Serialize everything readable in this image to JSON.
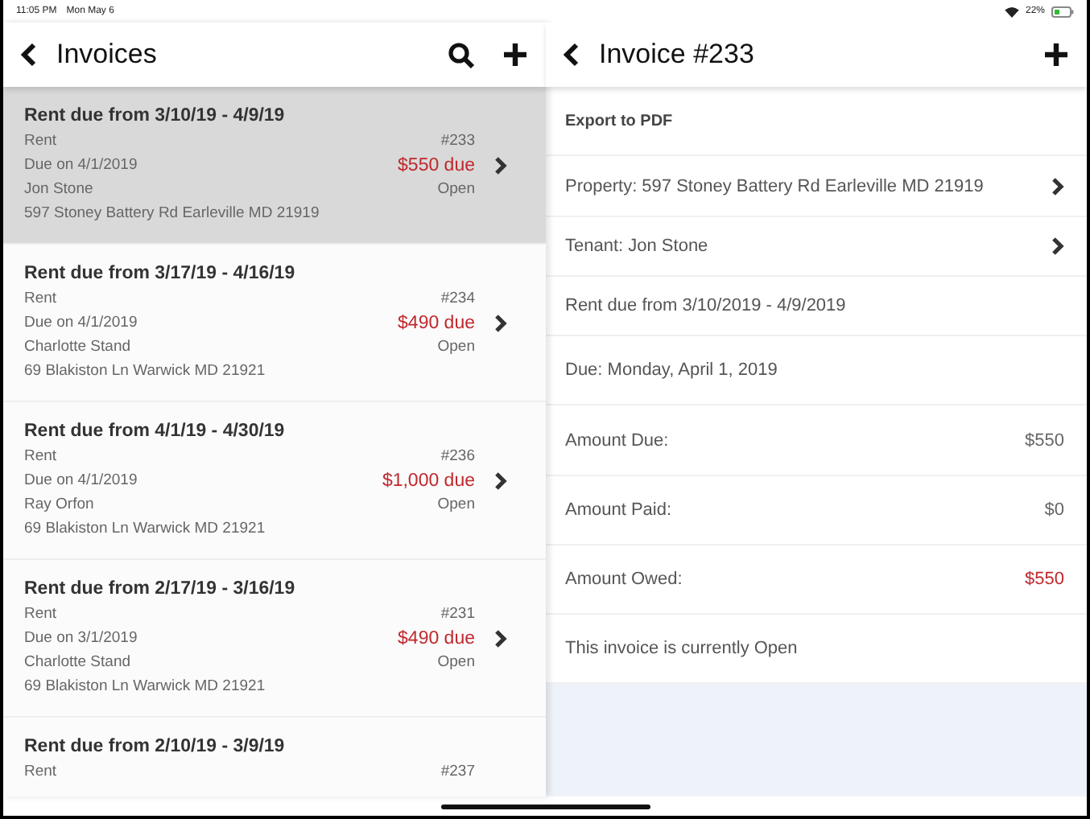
{
  "status_bar": {
    "time": "11:05 PM",
    "date": "Mon May 6",
    "battery": "22%"
  },
  "list_header": {
    "title": "Invoices"
  },
  "invoices": [
    {
      "title": "Rent due from 3/10/19 - 4/9/19",
      "category": "Rent",
      "number": "#233",
      "due_on": "Due on 4/1/2019",
      "amount": "$550 due",
      "tenant": "Jon Stone",
      "status": "Open",
      "address": "597 Stoney Battery Rd Earleville MD 21919",
      "selected": true
    },
    {
      "title": "Rent due from 3/17/19 - 4/16/19",
      "category": "Rent",
      "number": "#234",
      "due_on": "Due on 4/1/2019",
      "amount": "$490 due",
      "tenant": "Charlotte Stand",
      "status": "Open",
      "address": "69 Blakiston Ln Warwick MD 21921",
      "selected": false
    },
    {
      "title": "Rent due from 4/1/19 - 4/30/19",
      "category": "Rent",
      "number": "#236",
      "due_on": "Due on 4/1/2019",
      "amount": "$1,000 due",
      "tenant": "Ray Orfon",
      "status": "Open",
      "address": "69 Blakiston Ln Warwick MD 21921",
      "selected": false
    },
    {
      "title": "Rent due from 2/17/19 - 3/16/19",
      "category": "Rent",
      "number": "#231",
      "due_on": "Due on 3/1/2019",
      "amount": "$490 due",
      "tenant": "Charlotte Stand",
      "status": "Open",
      "address": "69 Blakiston Ln Warwick MD 21921",
      "selected": false
    },
    {
      "title": "Rent due from 2/10/19 - 3/9/19",
      "category": "Rent",
      "number": "#237",
      "selected": false
    }
  ],
  "detail_header": {
    "title": "Invoice #233"
  },
  "detail_rows": [
    {
      "kind": "action",
      "label": "Export to PDF"
    },
    {
      "kind": "link",
      "label": "Property: 597 Stoney Battery Rd Earleville MD 21919"
    },
    {
      "kind": "link",
      "label": "Tenant: Jon Stone"
    },
    {
      "kind": "text",
      "label": "Rent due from 3/10/2019 - 4/9/2019"
    },
    {
      "kind": "text",
      "label": "Due: Monday, April 1, 2019"
    },
    {
      "kind": "amount",
      "label": "Amount Due:",
      "value": "$550",
      "alert": false
    },
    {
      "kind": "amount",
      "label": "Amount Paid:",
      "value": "$0",
      "alert": false
    },
    {
      "kind": "amount",
      "label": "Amount Owed:",
      "value": "$550",
      "alert": true
    },
    {
      "kind": "text",
      "label": "This invoice is currently Open"
    }
  ]
}
